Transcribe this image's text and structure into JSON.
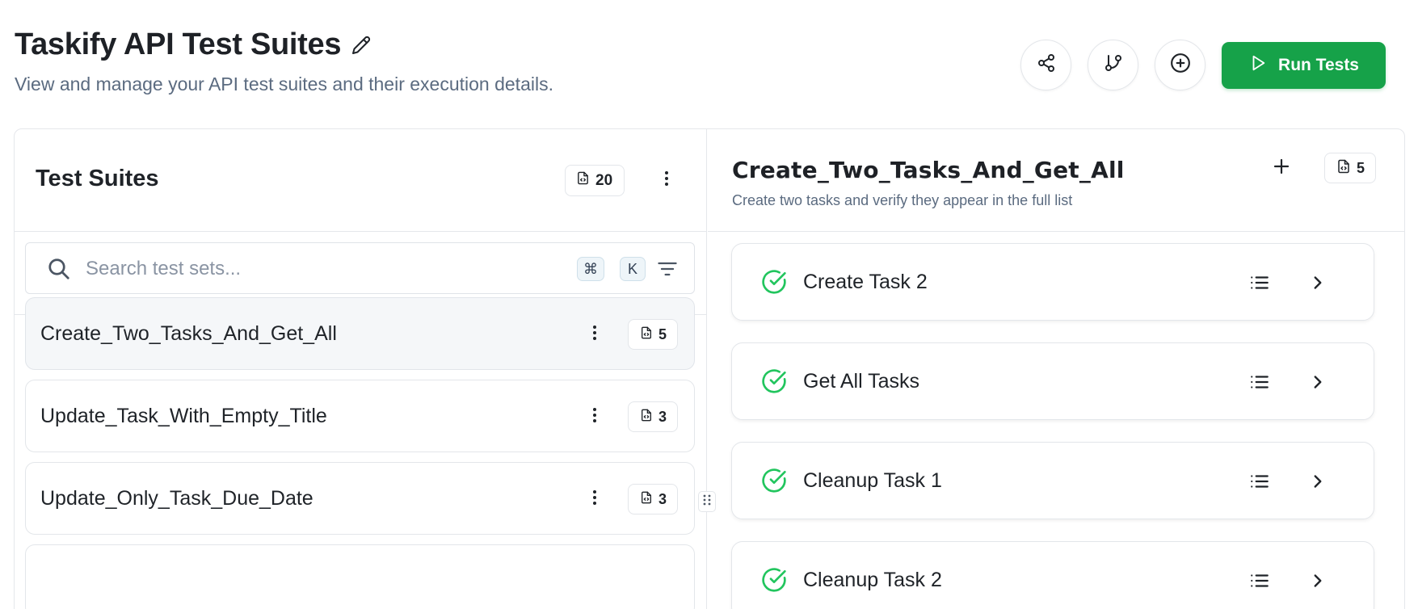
{
  "header": {
    "title": "Taskify API Test Suites",
    "subtitle": "View and manage your API test suites and their execution details.",
    "run_label": "Run Tests",
    "accent_color": "#16a249"
  },
  "left_panel": {
    "title": "Test Suites",
    "count": "20",
    "search": {
      "placeholder": "Search test sets...",
      "value": "",
      "shortcut_cmd": "⌘",
      "shortcut_key": "K"
    },
    "suites": [
      {
        "name": "Create_Two_Tasks_And_Get_All",
        "count": "5",
        "selected": true
      },
      {
        "name": "Update_Task_With_Empty_Title",
        "count": "3",
        "selected": false
      },
      {
        "name": "Update_Only_Task_Due_Date",
        "count": "3",
        "selected": false
      }
    ]
  },
  "right_panel": {
    "title": "Create_Two_Tasks_And_Get_All",
    "description": "Create two tasks and verify they appear in the full list",
    "count": "5",
    "tests": [
      {
        "name": "Create Task 2",
        "status": "passed"
      },
      {
        "name": "Get All Tasks",
        "status": "passed"
      },
      {
        "name": "Cleanup Task 1",
        "status": "passed"
      },
      {
        "name": "Cleanup Task 2",
        "status": "passed"
      }
    ]
  },
  "icons": {
    "edit": "pencil-icon",
    "share": "share-icon",
    "branch": "git-branch-icon",
    "add": "plus-circle-icon",
    "run": "play-icon",
    "file": "file-code-icon",
    "more": "more-vertical-icon",
    "search": "search-icon",
    "filter": "filter-icon",
    "status": "check-circle-icon",
    "details": "list-icon",
    "open": "chevron-right-icon"
  }
}
